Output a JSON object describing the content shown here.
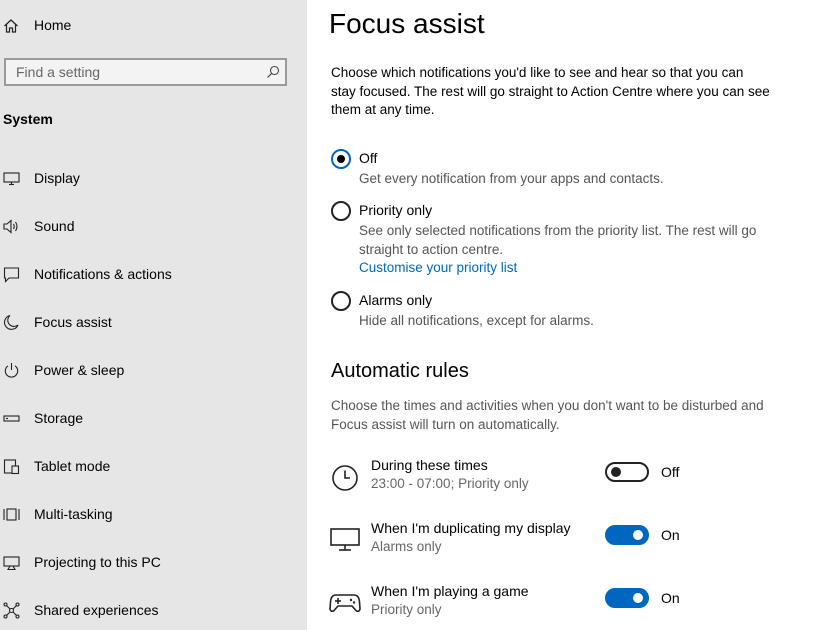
{
  "sidebar": {
    "home_label": "Home",
    "search_placeholder": "Find a setting",
    "section_label": "System",
    "items": [
      {
        "label": "Display",
        "icon": "monitor-icon"
      },
      {
        "label": "Sound",
        "icon": "speaker-icon"
      },
      {
        "label": "Notifications & actions",
        "icon": "notification-icon"
      },
      {
        "label": "Focus assist",
        "icon": "moon-icon"
      },
      {
        "label": "Power & sleep",
        "icon": "power-icon"
      },
      {
        "label": "Storage",
        "icon": "storage-icon"
      },
      {
        "label": "Tablet mode",
        "icon": "tablet-icon"
      },
      {
        "label": "Multi-tasking",
        "icon": "multitasking-icon"
      },
      {
        "label": "Projecting to this PC",
        "icon": "projecting-icon"
      },
      {
        "label": "Shared experiences",
        "icon": "shared-icon"
      }
    ]
  },
  "main": {
    "title": "Focus assist",
    "description": "Choose which notifications you'd like to see and hear so that you can stay focused. The rest will go straight to Action Centre where you can see them at any time.",
    "options": [
      {
        "label": "Off",
        "description": "Get every notification from your apps and contacts.",
        "selected": true
      },
      {
        "label": "Priority only",
        "description": "See only selected notifications from the priority list. The rest will go straight to action centre.",
        "link": "Customise your priority list",
        "selected": false
      },
      {
        "label": "Alarms only",
        "description": "Hide all notifications, except for alarms.",
        "selected": false
      }
    ],
    "rules_title": "Automatic rules",
    "rules_description": "Choose the times and activities when you don't want to be disturbed and Focus assist will turn on automatically.",
    "rules": [
      {
        "title": "During these times",
        "subtitle": "23:00 - 07:00; Priority only",
        "state": "Off",
        "icon": "clock-icon"
      },
      {
        "title": "When I'm duplicating my display",
        "subtitle": "Alarms only",
        "state": "On",
        "icon": "display-icon"
      },
      {
        "title": "When I'm playing a game",
        "subtitle": "Priority only",
        "state": "On",
        "icon": "gamepad-icon"
      }
    ]
  },
  "colors": {
    "accent": "#0067c0",
    "sidebar_bg": "#e6e6e6"
  }
}
